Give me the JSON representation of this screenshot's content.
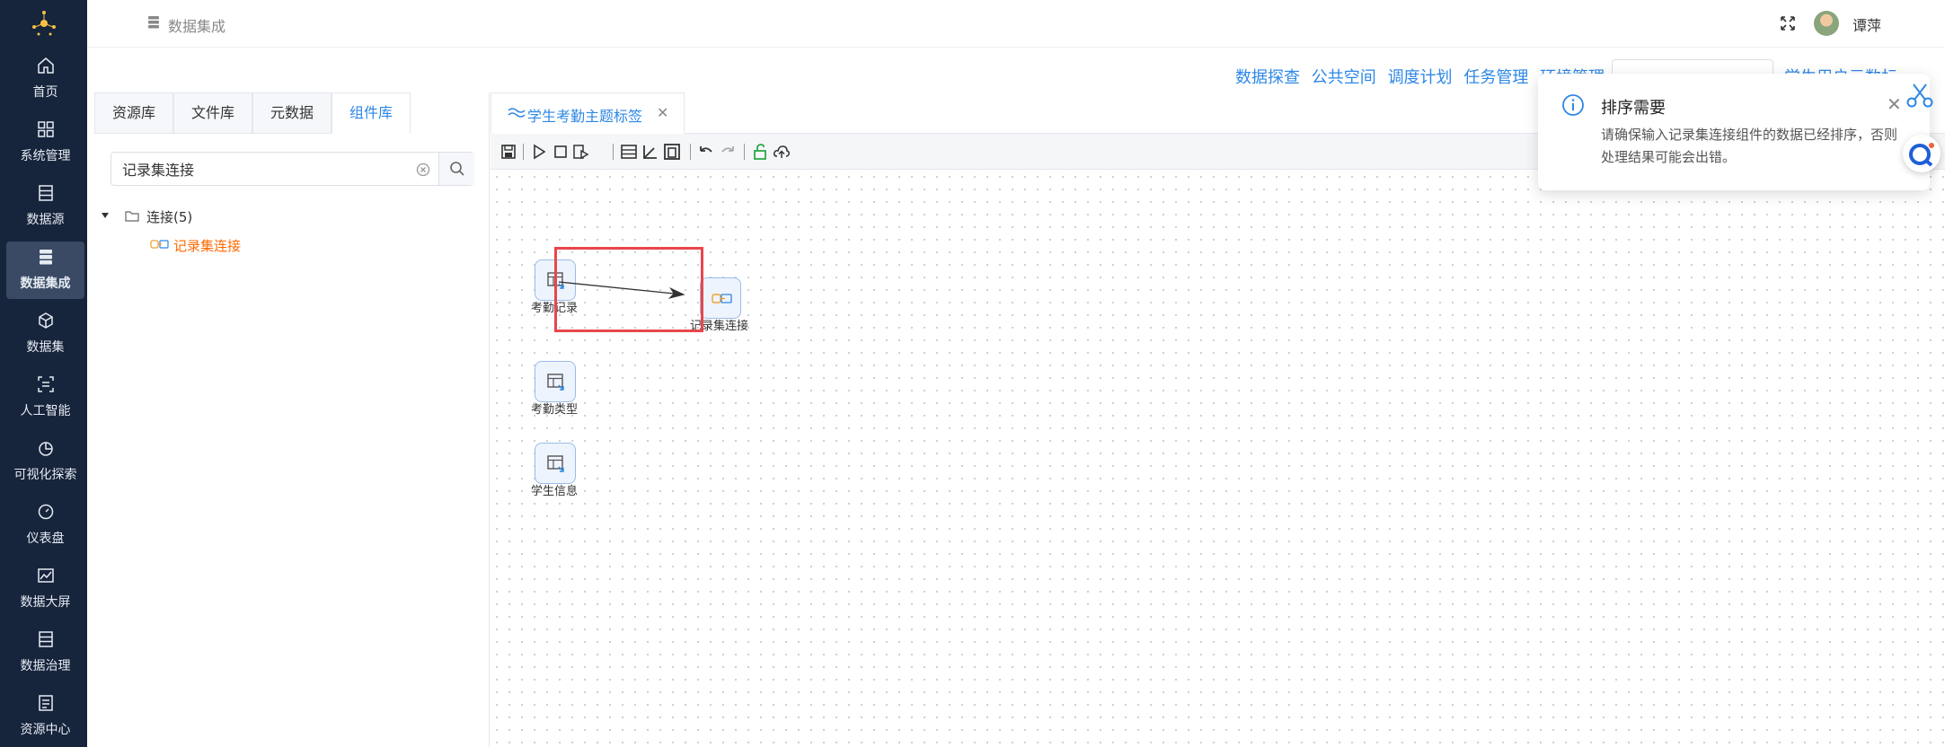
{
  "sidebar": {
    "items": [
      {
        "label": "首页",
        "icon": "home-icon"
      },
      {
        "label": "系统管理",
        "icon": "grid-icon"
      },
      {
        "label": "数据源",
        "icon": "database-icon"
      },
      {
        "label": "数据集成",
        "icon": "integration-icon",
        "active": true
      },
      {
        "label": "数据集",
        "icon": "cube-icon"
      },
      {
        "label": "人工智能",
        "icon": "ai-scan-icon"
      },
      {
        "label": "可视化探索",
        "icon": "pie-chart-icon"
      },
      {
        "label": "仪表盘",
        "icon": "gauge-icon"
      },
      {
        "label": "数据大屏",
        "icon": "line-chart-icon"
      },
      {
        "label": "数据治理",
        "icon": "governance-icon"
      },
      {
        "label": "资源中心",
        "icon": "resource-icon"
      }
    ]
  },
  "header": {
    "breadcrumb": "数据集成",
    "username": "谭萍"
  },
  "toplinks": [
    "数据探查",
    "公共空间",
    "调度计划",
    "任务管理",
    "环境管理"
  ],
  "env_link": "学生用户元数标",
  "library": {
    "tabs": [
      "资源库",
      "文件库",
      "元数据",
      "组件库"
    ],
    "active_tab": "组件库",
    "search_value": "记录集连接",
    "tree": {
      "folder": "连接(5)",
      "leaf": "记录集连接"
    }
  },
  "editor": {
    "tab_label": "学生考勤主题标签",
    "tab_close": "✕",
    "nodes": [
      {
        "label": "考勤记录"
      },
      {
        "label": "记录集连接"
      },
      {
        "label": "考勤类型"
      },
      {
        "label": "学生信息"
      }
    ]
  },
  "notification": {
    "title": "排序需要",
    "body": "请确保输入记录集连接组件的数据已经排序，否则处理结果可能会出错。",
    "close": "✕"
  },
  "colors": {
    "sidebar_bg": "#16243c",
    "accent": "#2d87e6",
    "leaf_orange": "#ff6a00",
    "highlight_red": "#e9464c"
  }
}
